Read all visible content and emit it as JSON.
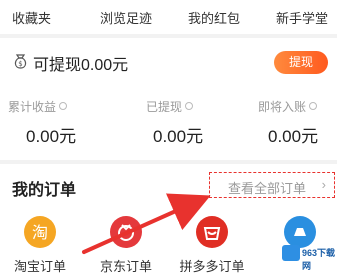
{
  "tabs": [
    {
      "label": "收藏夹"
    },
    {
      "label": "浏览足迹"
    },
    {
      "label": "我的红包"
    },
    {
      "label": "新手学堂"
    }
  ],
  "withdraw": {
    "label": "可提现0.00元",
    "button_label": "提现"
  },
  "stats": [
    {
      "label": "累计收益",
      "value": "0.00元"
    },
    {
      "label": "已提现",
      "value": "0.00元"
    },
    {
      "label": "即将入账",
      "value": "0.00元"
    }
  ],
  "orders": {
    "title": "我的订单",
    "view_all_label": "查看全部订单",
    "items": [
      {
        "label": "淘宝订单",
        "icon": "taobao-icon",
        "color": "#f5a623",
        "glyph": "淘"
      },
      {
        "label": "京东订单",
        "icon": "jd-icon",
        "color": "#e4393c",
        "glyph": ""
      },
      {
        "label": "拼多多订单",
        "icon": "pinduoduo-icon",
        "color": "#e02e24",
        "glyph": ""
      },
      {
        "label": "",
        "icon": "meituan-icon",
        "color": "#2a8fe0",
        "glyph": ""
      }
    ]
  },
  "watermark": {
    "text": "963下载网"
  },
  "annotation": {
    "color": "#e8322e"
  }
}
